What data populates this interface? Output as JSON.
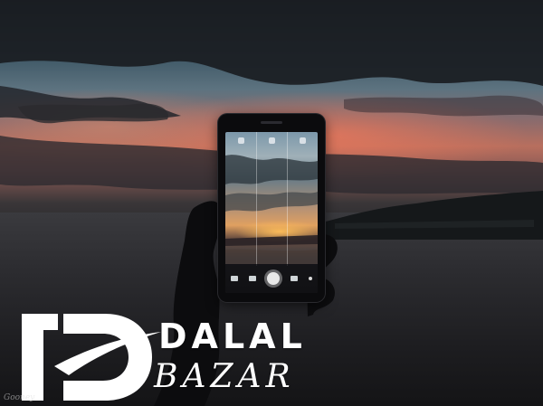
{
  "image": {
    "subject": "hand holding smartphone photographing sunset over sea",
    "phone_app": "camera",
    "icons": [
      "camera-mode-icon",
      "settings-icon",
      "flash-icon",
      "gallery-thumb-icon",
      "shutter-icon",
      "video-icon",
      "menu-dot-icon"
    ]
  },
  "watermark": {
    "line1": "DALAL",
    "line2": "BAZAR",
    "signature": "Gooney"
  },
  "colors": {
    "sky_glow": "#b86f5e",
    "sea_dark": "#1d1d20",
    "logo_white": "#ffffff"
  }
}
